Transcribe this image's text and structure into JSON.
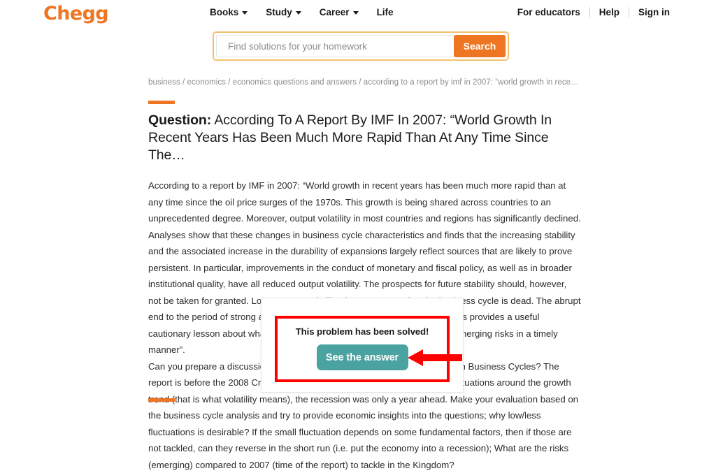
{
  "site": {
    "logo_text": "Chegg",
    "brand_color": "#EE7623"
  },
  "header": {
    "nav_items": [
      {
        "label": "Books",
        "has_caret": true,
        "icon": "chevron-down-icon"
      },
      {
        "label": "Study",
        "has_caret": true,
        "icon": "chevron-down-icon"
      },
      {
        "label": "Career",
        "has_caret": true,
        "icon": "chevron-down-icon"
      },
      {
        "label": "Life",
        "has_caret": false,
        "icon": ""
      }
    ],
    "nav_right": [
      {
        "label": "For educators"
      },
      {
        "label": "Help"
      },
      {
        "label": "Sign in"
      }
    ]
  },
  "search": {
    "placeholder": "Find solutions for your homework",
    "value": "",
    "button_label": "Search",
    "focus_ring_color": "#F5C26B",
    "button_color": "#EE7623"
  },
  "breadcrumb": {
    "text": "business / economics / economics questions and answers / according to a report by imf in 2007: “world growth in recent…"
  },
  "question": {
    "label": "Question:",
    "title": " According To A Report By IMF In 2007: “World Growth In Recent Years Has Been Much More Rapid Than At Any Time Since The…",
    "body_paragraph_1": "According to a report by IMF in 2007: “World growth in recent years has been much more rapid than at any time since the oil price surges of the 1970s. This growth is being shared across countries to an unprecedented degree. Moreover, output volatility in most countries and regions has significantly declined. Analyses show that these changes in business cycle characteristics and finds that the increasing stability and the associated increase in the durability of expansions largely reflect sources that are likely to prove persistent. In particular, improvements in the conduct of monetary and fiscal policy, as well as in broader institutional quality, have all reduced output volatility. The prospects for future stability should, however, not be taken for granted. Low average volatility does not mean that the business cycle is dead. The abrupt end to the period of strong and sustained growth in the 1960s and early 1970s provides a useful cautionary lesson about what can happen if policies do not adjust to tackle emerging risks in a timely manner”.",
    "body_paragraph_2": "Can you prepare a discussion of the above passage using your knowledge on Business Cycles? The report is before the 2008 Crisis. Although the report mentions the smaller fluctuations around the growth trend (that is what volatility means), the recession was only a year ahead. Make your evaluation based on the business cycle analysis and try to provide economic insights into the questions; why low/less fluctuations is desirable? If the small fluctuation depends on some fundamental factors, then if those are not tackled, can they reverse in the short run (i.e. put the economy into a recession); What are the risks (emerging) compared to 2007 (time of the report) to tackle in the Kingdom?"
  },
  "modal": {
    "headline": "This problem has been solved!",
    "button_label": "See the answer",
    "button_color": "#4AA3A0",
    "highlight_color": "#FF0000"
  },
  "annotation": {
    "arrow_color": "#FF0000",
    "arrow_direction": "left"
  }
}
